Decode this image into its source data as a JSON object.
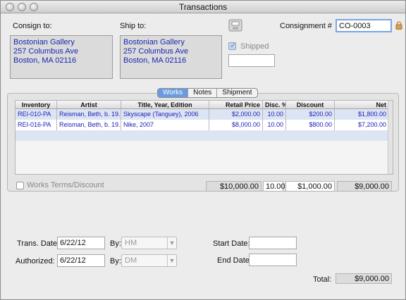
{
  "window": {
    "title": "Transactions"
  },
  "consign": {
    "label": "Consign to:",
    "address": "Bostonian Gallery\n257 Columbus Ave\nBoston, MA 02116"
  },
  "ship": {
    "label": "Ship to:",
    "address": "Bostonian Gallery\n257 Columbus Ave\nBoston, MA 02116"
  },
  "shipped_label": "Shipped",
  "consignment": {
    "label": "Consignment #",
    "value": "CO-0003"
  },
  "tabs": [
    "Works",
    "Notes",
    "Shipment"
  ],
  "table": {
    "columns": [
      "Inventory",
      "Artist",
      "Title, Year, Edition",
      "Retail Price",
      "Disc. %",
      "Discount",
      "Net"
    ],
    "rows": [
      [
        "REI-010-PA",
        "Reisman, Beth, b. 19...",
        "Skyscape (Tanguey), 2006",
        "$2,000.00",
        "10.00",
        "$200.00",
        "$1,800.00"
      ],
      [
        "REI-016-PA",
        "Reisman, Beth, b. 19...",
        "Nike, 2007",
        "$8,000.00",
        "10.00",
        "$800.00",
        "$7,200.00"
      ]
    ]
  },
  "works_terms_label": "Works Terms/Discount",
  "totals": {
    "retail": "$10,000.00",
    "disc": "10.00",
    "discount": "$1,000.00",
    "net": "$9,000.00"
  },
  "trans_date": {
    "label": "Trans. Date:",
    "value": "6/22/12",
    "by_label": "By:",
    "by_value": "HM"
  },
  "authorized": {
    "label": "Authorized:",
    "value": "6/22/12",
    "by_label": "By:",
    "by_value": "DM"
  },
  "start_date_label": "Start Date:",
  "end_date_label": "End Date:",
  "total": {
    "label": "Total:",
    "value": "$9,000.00"
  },
  "icons": {
    "save": "save-icon",
    "lock": "lock-icon"
  },
  "colors": {
    "accent": "#6a9ae0",
    "link_text": "#1a28b0",
    "row_alt": "#dce5f4"
  }
}
